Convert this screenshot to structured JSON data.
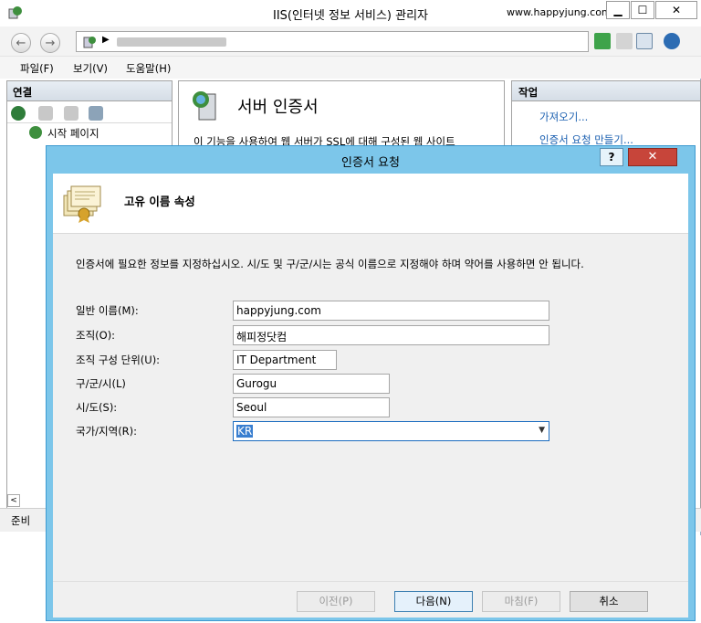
{
  "window": {
    "title": "IIS(인터넷 정보 서비스) 관리자",
    "site_watermark": "www.happyjung.com",
    "minimize": "▁",
    "maximize": "☐",
    "close": "✕"
  },
  "menu": [
    "파일(F)",
    "보기(V)",
    "도움말(H)"
  ],
  "connections": {
    "header": "연결",
    "tree": [
      "시작 페이지"
    ]
  },
  "feature": {
    "title": "서버 인증서",
    "description": "이 기능을 사용하여 웹 서버가 SSL에 대해 구성된 웹 사이트"
  },
  "actions": {
    "header": "작업",
    "links": [
      "가져오기...",
      "인증서 요청 만들기..."
    ]
  },
  "status_bar": {
    "text": "준비"
  },
  "dialog": {
    "title": "인증서 요청",
    "help": "?",
    "close": "✕",
    "header": "고유 이름 속성",
    "description": "인증서에 필요한 정보를 지정하십시오. 시/도 및 구/군/시는 공식 이름으로 지정해야 하며 약어를 사용하면 안 됩니다.",
    "fields": {
      "common_name": {
        "label": "일반 이름(M):",
        "value": "happyjung.com"
      },
      "organization": {
        "label": "조직(O):",
        "value": "해피정닷컴"
      },
      "org_unit": {
        "label": "조직 구성 단위(U):",
        "value": "IT Department"
      },
      "city": {
        "label": "구/군/시(L)",
        "value": "Gurogu"
      },
      "state": {
        "label": "시/도(S):",
        "value": "Seoul"
      },
      "country": {
        "label": "국가/지역(R):",
        "value": "KR"
      }
    },
    "buttons": {
      "previous": "이전(P)",
      "next": "다음(N)",
      "finish": "마침(F)",
      "cancel": "취소"
    }
  }
}
